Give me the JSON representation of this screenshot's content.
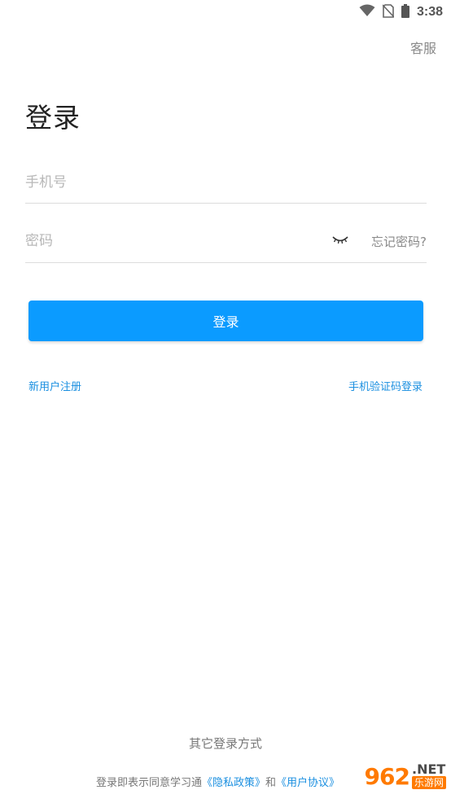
{
  "status_bar": {
    "time": "3:38",
    "icons": [
      "wifi-icon",
      "no-sim-icon",
      "battery-icon"
    ]
  },
  "header": {
    "service_label": "客服",
    "title": "登录"
  },
  "form": {
    "phone_placeholder": "手机号",
    "password_placeholder": "密码",
    "forgot_label": "忘记密码?",
    "eye_icon": "eye-closed-icon",
    "login_label": "登录"
  },
  "links": {
    "register": "新用户注册",
    "sms_login": "手机验证码登录"
  },
  "footer": {
    "other_login": "其它登录方式",
    "agreement_prefix": "登录即表示同意学习通",
    "privacy": "《隐私政策》",
    "and": "和",
    "user_agreement": "《用户协议》"
  },
  "watermark": {
    "badge": "962",
    "net": ".NET",
    "sub": "乐游网"
  },
  "colors": {
    "accent": "#0b9bff",
    "link": "#1a8fe0",
    "watermark": "#ff7a00"
  }
}
